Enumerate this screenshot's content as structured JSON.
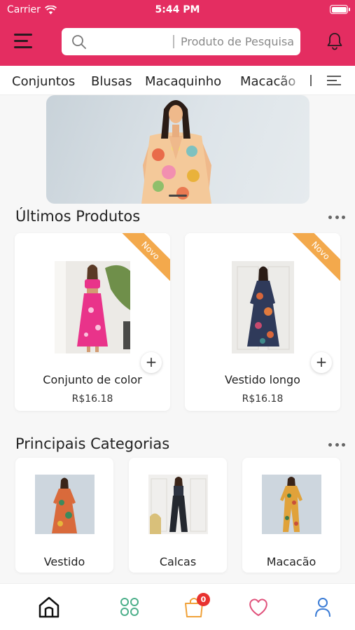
{
  "status_bar": {
    "carrier": "Carrier",
    "time": "5:44 PM"
  },
  "header": {
    "search_placeholder": "Produto de Pesquisa",
    "accent_color": "#e42d61"
  },
  "categories_tabs": [
    "Conjuntos",
    "Blusas",
    "Macaquinho",
    "Macacão"
  ],
  "latest_products": {
    "title": "Últimos Produtos",
    "items": [
      {
        "name": "Conjunto de color",
        "price": "R$16.18",
        "badge": "Novo"
      },
      {
        "name": "Vestido longo",
        "price": "R$16.18",
        "badge": "Novo"
      }
    ]
  },
  "top_categories": {
    "title": "Principais Categorias",
    "items": [
      {
        "name": "Vestido"
      },
      {
        "name": "Calcas"
      },
      {
        "name": "Macacão"
      }
    ]
  },
  "bottom_nav": {
    "items": [
      "home-icon",
      "grid-icon",
      "cart-icon",
      "heart-icon",
      "user-icon"
    ],
    "cart_count": "0"
  }
}
